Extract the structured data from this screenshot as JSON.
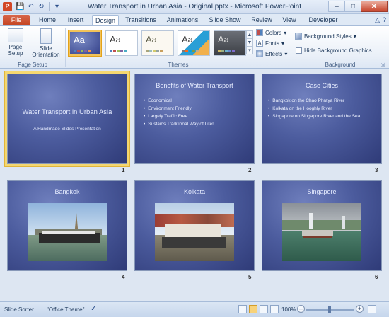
{
  "window": {
    "title": "Water Transport in Urban Asia - Original.pptx  -  Microsoft PowerPoint",
    "app_icon": "P"
  },
  "tabs": [
    "File",
    "Home",
    "Insert",
    "Design",
    "Transitions",
    "Animations",
    "Slide Show",
    "Review",
    "View",
    "Developer"
  ],
  "active_tab": "Design",
  "ribbon": {
    "page_setup": {
      "page_setup_label": "Page Setup",
      "orientation_label": "Slide Orientation",
      "group_label": "Page Setup"
    },
    "themes": {
      "group_label": "Themes",
      "theme_thumb_text": "Aa",
      "colors_label": "Colors",
      "fonts_label": "Fonts",
      "effects_label": "Effects"
    },
    "background": {
      "styles_label": "Background Styles",
      "hide_graphics_label": "Hide Background Graphics",
      "group_label": "Background"
    }
  },
  "slides": [
    {
      "number": "1",
      "title": "Water Transport in Urban Asia",
      "subtitle": "A Handmade Slides Presentation"
    },
    {
      "number": "2",
      "title": "Benefits of Water Transport",
      "bullets": [
        "Economical",
        "Environment Friendly",
        "Largely Traffic Free",
        "Sustains Traditional Way of Life!"
      ]
    },
    {
      "number": "3",
      "title": "Case Cities",
      "bullets": [
        "Bangkok on the Chao Phraya River",
        "Kolkata on the Hooghly River",
        "Singapore on Singapore River and the Sea"
      ]
    },
    {
      "number": "4",
      "title": "Bangkok"
    },
    {
      "number": "5",
      "title": "Kolkata"
    },
    {
      "number": "6",
      "title": "Singapore"
    }
  ],
  "status": {
    "view": "Slide Sorter",
    "theme": "\"Office Theme\"",
    "zoom": "100%"
  }
}
